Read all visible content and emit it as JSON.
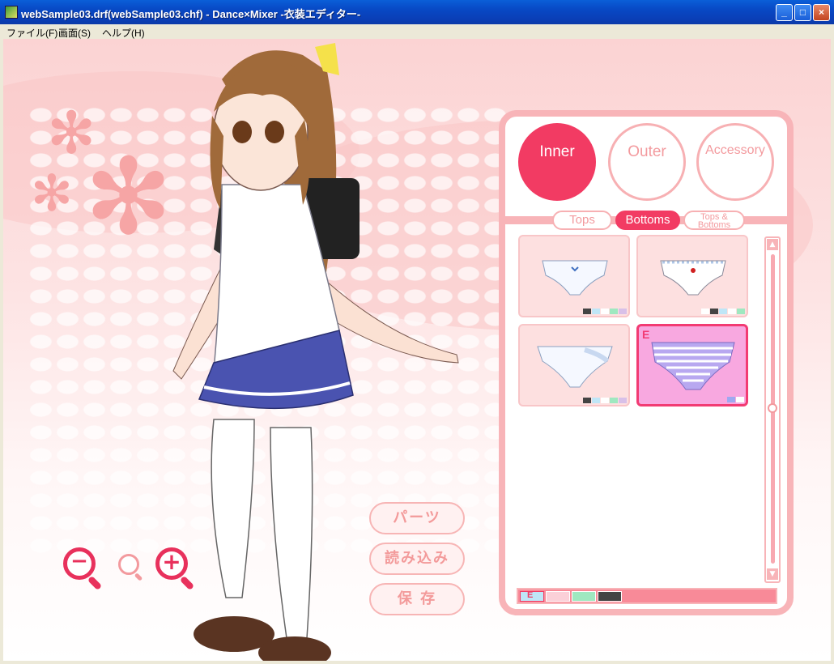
{
  "window": {
    "title": "webSample03.drf(webSample03.chf) - Dance×Mixer -衣装エディター-",
    "minimize": "_",
    "maximize": "□",
    "close": "×"
  },
  "menu": [
    {
      "label": "ファイル(F)"
    },
    {
      "label": "画面(S)"
    },
    {
      "label": "ヘルプ(H)"
    }
  ],
  "zoom": {
    "out": "−",
    "reset": "",
    "in": "+"
  },
  "actions": {
    "parts": "パーツ",
    "load": "読み込み",
    "save": "保 存"
  },
  "categories": [
    {
      "label": "Inner",
      "active": true
    },
    {
      "label": "Outer",
      "active": false
    },
    {
      "label": "Accessory",
      "active": false
    }
  ],
  "subtabs": [
    {
      "label": "Tops",
      "active": false
    },
    {
      "label": "Bottoms",
      "active": true
    },
    {
      "label": "Tops & Bottoms",
      "active": false
    }
  ],
  "items": [
    {
      "equipped_badge": "",
      "selected": false
    },
    {
      "equipped_badge": "",
      "selected": false
    },
    {
      "equipped_badge": "",
      "selected": false
    },
    {
      "equipped_badge": "E",
      "selected": true
    }
  ],
  "colorbar": {
    "badge": "E",
    "colors": [
      "#bfe6f7",
      "#fbd0d8",
      "#9fe8c0",
      "#444444"
    ]
  },
  "colors": {
    "accent": "#f23b63",
    "panel_border": "#f8b4b8"
  }
}
